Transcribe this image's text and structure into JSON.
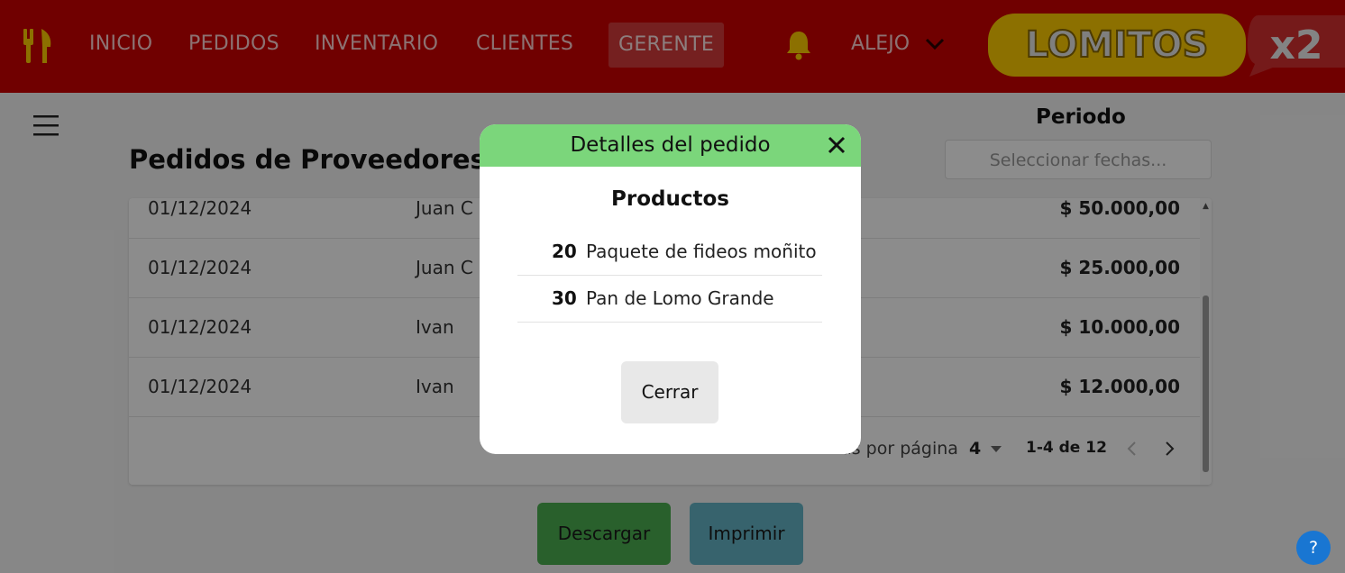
{
  "header": {
    "nav": [
      "INICIO",
      "PEDIDOS",
      "INVENTARIO",
      "CLIENTES",
      "GERENTE"
    ],
    "active": "GERENTE",
    "user": "ALEJO",
    "logo_text": "LOMITOS",
    "logo_badge": "x2",
    "brand_icon": "fork-knife-icon"
  },
  "page": {
    "title": "Pedidos de Proveedores",
    "period_label": "Periodo",
    "period_placeholder": "Seleccionar fechas...",
    "rows": [
      {
        "date": "01/12/2024",
        "who": "Juan C",
        "amount": "$ 50.000,00"
      },
      {
        "date": "01/12/2024",
        "who": "Juan C",
        "amount": "$ 25.000,00"
      },
      {
        "date": "01/12/2024",
        "who": "Ivan",
        "amount": "$ 10.000,00"
      },
      {
        "date": "01/12/2024",
        "who": "Ivan",
        "amount": "$ 12.000,00"
      }
    ],
    "pager": {
      "rows_label": "Filas por página",
      "rows_value": "4",
      "range": "1-4 de 12"
    },
    "buttons": {
      "download": "Descargar",
      "print": "Imprimir"
    },
    "help": "?"
  },
  "modal": {
    "title": "Detalles del pedido",
    "subtitle": "Productos",
    "products": [
      {
        "qty": "20",
        "name": "Paquete de fideos moñito"
      },
      {
        "qty": "30",
        "name": "Pan de Lomo Grande"
      }
    ],
    "close_button": "Cerrar"
  },
  "colors": {
    "header_bg": "#cc0000",
    "modal_header_bg": "#7bd67b",
    "accent_yellow": "#ffcc00",
    "download_btn": "#4caf50",
    "print_btn": "#64b5c6",
    "help_btn": "#1976d2"
  }
}
